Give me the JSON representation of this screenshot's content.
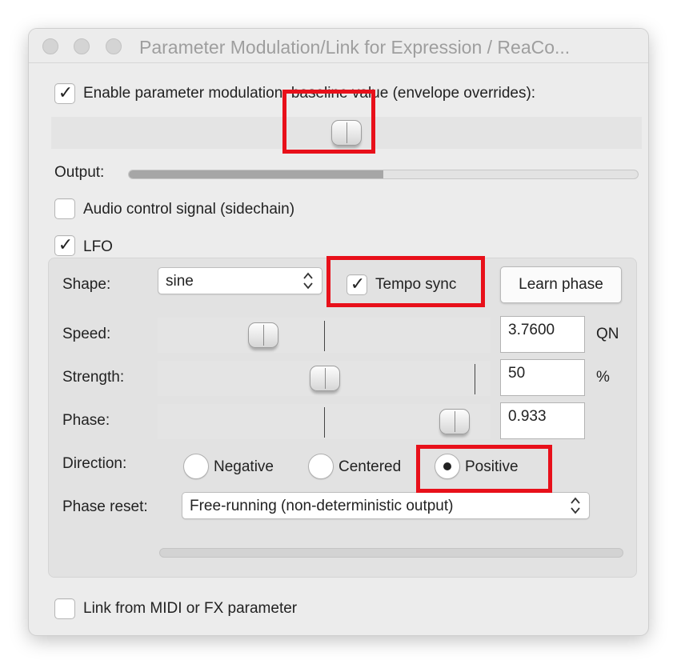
{
  "window": {
    "title": "Parameter Modulation/Link for Expression / ReaCo..."
  },
  "baseline": {
    "enable_label": "Enable parameter modulation, baseline value (envelope overrides):",
    "enabled": true
  },
  "output": {
    "label": "Output:",
    "level_fraction": 0.5
  },
  "audio_control": {
    "label": "Audio control signal (sidechain)",
    "checked": false
  },
  "lfo": {
    "label": "LFO",
    "checked": true,
    "shape_label": "Shape:",
    "shape_value": "sine",
    "tempo_sync_label": "Tempo sync",
    "tempo_sync_checked": true,
    "learn_phase_label": "Learn phase",
    "speed_label": "Speed:",
    "speed_value": "3.7600",
    "speed_unit": "QN",
    "strength_label": "Strength:",
    "strength_value": "50",
    "strength_unit": "%",
    "phase_label": "Phase:",
    "phase_value": "0.933",
    "direction_label": "Direction:",
    "direction_options": [
      "Negative",
      "Centered",
      "Positive"
    ],
    "direction_selected": "Positive",
    "phase_reset_label": "Phase reset:",
    "phase_reset_value": "Free-running (non-deterministic output)"
  },
  "link": {
    "label": "Link from MIDI or FX parameter",
    "checked": false
  },
  "colors": {
    "highlight": "#e8101a",
    "window_bg": "#ececec"
  }
}
